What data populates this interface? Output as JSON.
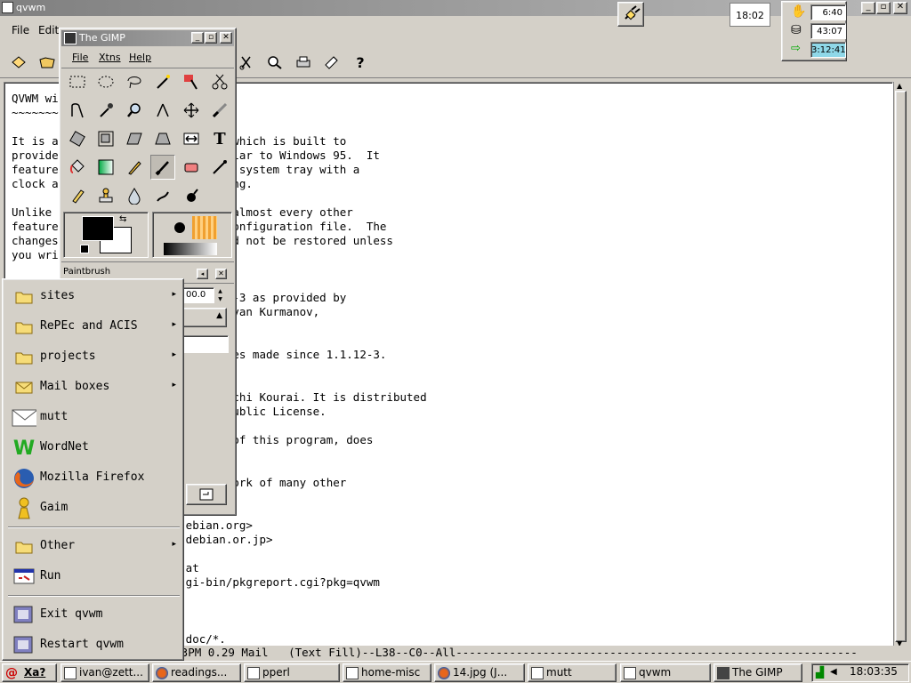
{
  "main_window": {
    "title": "qvwm",
    "controls": [
      "_",
      "▫",
      "✕"
    ]
  },
  "menubar": {
    "items": [
      "File",
      "Edit"
    ]
  },
  "toolbar": {
    "help_label": "?"
  },
  "editor": {
    "lines": [
      "QVWM wi",
      "~~~~~~~~",
      "",
      "It is a                      er, which is built to",
      "provide                      similar to Windows 95.  It",
      "feature                      r, a system tray with a",
      "clock a                      tching.",
      "",
      "Unlike                       and almost every other",
      "feature                      al configuration file.  The",
      "changes                      would not be restored unless",
      "you wri",
      "",
      "",
      "                             1.12-3 as provided by",
      "                             by Ivan Kurmanov,",
      "",
      "",
      "                             hanges made since 1.1.12-3.",
      "",
      "",
      "                             Kenichi Kourai. It is distributed",
      "                             al Public License.",
      "",
      "                             hor of this program, does",
      "",
      "",
      "                             of work of many other",
      "                             :",
      "",
      "                          ebian.org>",
      "                          debian.or.jp>",
      "",
      "                          at",
      "                          gi-bin/pkgreport.cgi?pkg=qvwm",
      "",
      "",
      "",
      "                          doc/*."
    ],
    "modeline": "                          3PM 0.29 Mail   (Text Fill)--L38--C0--All------------------------------------------------------------"
  },
  "tray": {
    "clock": "18:02",
    "monitors": [
      {
        "icon": "hand-icon",
        "value": "6:40"
      },
      {
        "icon": "disk-icon",
        "value": "43:07"
      },
      {
        "icon": "plug-in-icon",
        "value": "3:12:41"
      }
    ]
  },
  "gimp": {
    "title": "The GIMP",
    "menu": [
      "File",
      "Xtns",
      "Help"
    ],
    "tool_options_title": "Paintbrush",
    "spin_value": "00.0"
  },
  "start_menu": {
    "items": [
      {
        "label": "sites",
        "icon": "folder-icon",
        "submenu": true
      },
      {
        "label": "RePEc and ACIS",
        "icon": "folder-icon",
        "submenu": true
      },
      {
        "label": "projects",
        "icon": "folder-icon",
        "submenu": true
      },
      {
        "label": "Mail boxes",
        "icon": "mail-folder-icon",
        "submenu": true
      },
      {
        "label": "mutt",
        "icon": "envelope-icon",
        "submenu": false
      },
      {
        "label": "WordNet",
        "icon": "wordnet-icon",
        "submenu": false
      },
      {
        "label": "Mozilla Firefox",
        "icon": "firefox-icon",
        "submenu": false
      },
      {
        "label": "Gaim",
        "icon": "gaim-icon",
        "submenu": false
      },
      {
        "label": "Other",
        "icon": "folder-icon",
        "submenu": true
      },
      {
        "label": "Run",
        "icon": "run-icon",
        "submenu": false
      },
      {
        "label": "Exit qvwm",
        "icon": "exit-icon",
        "submenu": false
      },
      {
        "label": "Restart qvwm",
        "icon": "restart-icon",
        "submenu": false
      }
    ],
    "arrow": "▸"
  },
  "taskbar": {
    "start_label": "Xa?",
    "tasks": [
      "ivan@zett...",
      "readings...",
      "pperl",
      "home-misc",
      "14.jpg (J...",
      "mutt",
      "qvwm",
      "The GIMP"
    ],
    "time": "18:03:35"
  },
  "colors": {
    "title_active": "#808080",
    "desktop": "#d4d0c8",
    "editor_bg": "#ffffff",
    "gimp_fg": "#000000",
    "gimp_bg": "#ffffff"
  }
}
